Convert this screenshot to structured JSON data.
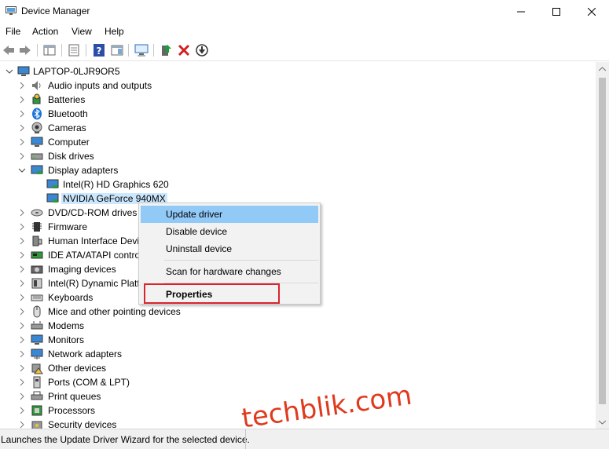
{
  "window": {
    "title": "Device Manager"
  },
  "menu": [
    "File",
    "Action",
    "View",
    "Help"
  ],
  "tree": {
    "root": "LAPTOP-0LJR9OR5",
    "categories": [
      "Audio inputs and outputs",
      "Batteries",
      "Bluetooth",
      "Cameras",
      "Computer",
      "Disk drives",
      "Display adapters",
      "DVD/CD-ROM drives",
      "Firmware",
      "Human Interface Devi",
      "IDE ATA/ATAPI control",
      "Imaging devices",
      "Intel(R) Dynamic Platf",
      "Keyboards",
      "Mice and other pointing devices",
      "Modems",
      "Monitors",
      "Network adapters",
      "Other devices",
      "Ports (COM & LPT)",
      "Print queues",
      "Processors",
      "Security devices"
    ],
    "display_children": [
      "Intel(R) HD Graphics 620",
      "NVIDIA GeForce 940MX"
    ]
  },
  "context_menu": {
    "items": [
      "Update driver",
      "Disable device",
      "Uninstall device",
      "Scan for hardware changes",
      "Properties"
    ]
  },
  "status": {
    "text": "Launches the Update Driver Wizard for the selected device."
  },
  "watermark": "techblik.com",
  "colors": {
    "selection": "#cce8ff",
    "menu_highlight": "#91c9f7",
    "annotation_box": "#d9262e",
    "watermark": "#e03a1e"
  }
}
